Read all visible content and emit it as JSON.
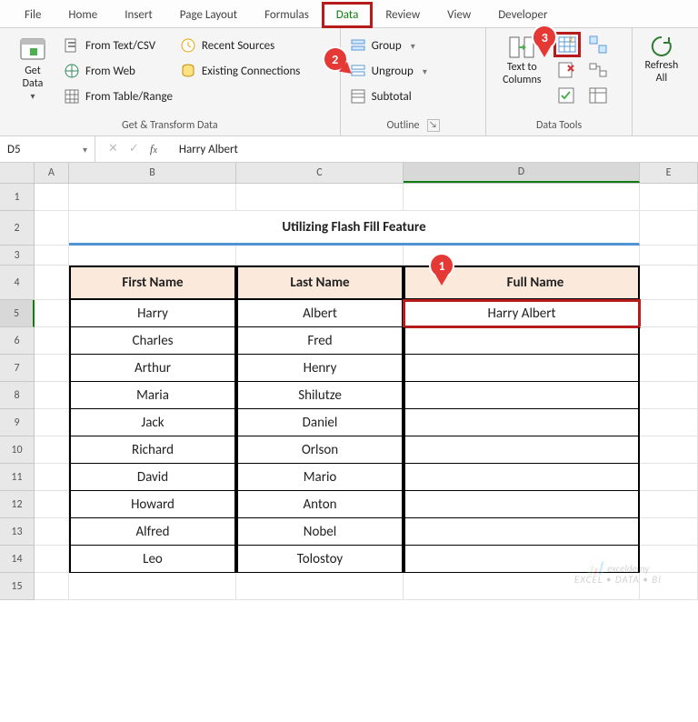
{
  "tabs": [
    "File",
    "Home",
    "Insert",
    "Page Layout",
    "Formulas",
    "Data",
    "Review",
    "View",
    "Developer"
  ],
  "active_tab": "Data",
  "ribbon": {
    "get_data": {
      "label": "Get\nData",
      "items": [
        "From Text/CSV",
        "From Web",
        "From Table/Range"
      ],
      "recent": "Recent Sources",
      "existing": "Existing Connections",
      "group_label": "Get & Transform Data"
    },
    "outline": {
      "group_label": "Outline",
      "group": "Group",
      "ungroup": "Ungroup",
      "subtotal": "Subtotal"
    },
    "datatools": {
      "group_label": "Data Tools",
      "texttocols": "Text to\nColumns"
    },
    "refresh": {
      "label": "Refresh\nAll"
    }
  },
  "namebox": "D5",
  "formula": "Harry Albert",
  "columns": [
    "A",
    "B",
    "C",
    "D",
    "E"
  ],
  "sheet_title": "Utilizing Flash Fill Feature",
  "headers": {
    "B": "First Name",
    "C": "Last Name",
    "D": "Full Name"
  },
  "data_rows": [
    {
      "n": 5,
      "B": "Harry",
      "C": "Albert",
      "D": "Harry Albert"
    },
    {
      "n": 6,
      "B": "Charles",
      "C": "Fred",
      "D": ""
    },
    {
      "n": 7,
      "B": "Arthur",
      "C": "Henry",
      "D": ""
    },
    {
      "n": 8,
      "B": "Maria",
      "C": "Shilutze",
      "D": ""
    },
    {
      "n": 9,
      "B": "Jack",
      "C": "Daniel",
      "D": ""
    },
    {
      "n": 10,
      "B": "Richard",
      "C": "Orlson",
      "D": ""
    },
    {
      "n": 11,
      "B": "David",
      "C": "Mario",
      "D": ""
    },
    {
      "n": 12,
      "B": "Howard",
      "C": "Anton",
      "D": ""
    },
    {
      "n": 13,
      "B": "Alfred",
      "C": "Nobel",
      "D": ""
    },
    {
      "n": 14,
      "B": "Leo",
      "C": "Tolostoy",
      "D": ""
    }
  ],
  "annotations": {
    "1": "1",
    "2": "2",
    "3": "3"
  },
  "watermark": {
    "brand": "exceldemy",
    "tag": "EXCEL • DATA • BI"
  }
}
